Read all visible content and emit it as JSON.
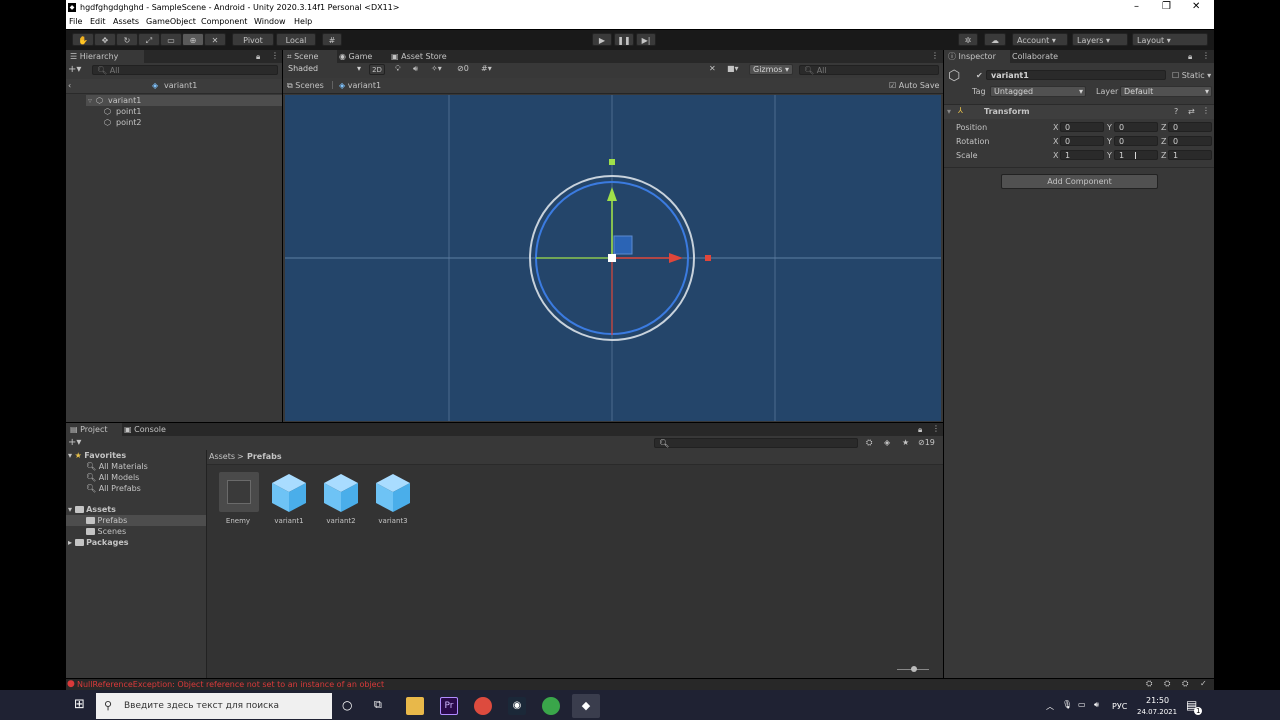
{
  "window": {
    "title": "hgdfghgdghghd - SampleScene - Android - Unity 2020.3.14f1 Personal <DX11>",
    "controls": [
      "–",
      "❐",
      "✕"
    ]
  },
  "menu": [
    "File",
    "Edit",
    "Assets",
    "GameObject",
    "Component",
    "Window",
    "Help"
  ],
  "toolbar": {
    "pivot": "Pivot",
    "local": "Local",
    "account": "Account",
    "layers": "Layers",
    "layout": "Layout"
  },
  "hierarchy": {
    "tab": "Hierarchy",
    "search_placeholder": "All",
    "header": "variant1",
    "items": [
      {
        "label": "variant1"
      },
      {
        "label": "point1"
      },
      {
        "label": "point2"
      }
    ]
  },
  "scene": {
    "tabs": [
      "Scene",
      "Game",
      "Asset Store"
    ],
    "shading": "Shaded",
    "mode2d": "2D",
    "hidden_count": "0",
    "gizmos": "Gizmos",
    "search_placeholder": "All",
    "breadcrumb": [
      "Scenes",
      "variant1"
    ],
    "auto_save": "Auto Save"
  },
  "inspector": {
    "tabs": [
      "Inspector",
      "Collaborate"
    ],
    "object_name": "variant1",
    "static": "Static",
    "tag_label": "Tag",
    "tag_value": "Untagged",
    "layer_label": "Layer",
    "layer_value": "Default",
    "component": "Transform",
    "rows": [
      {
        "label": "Position",
        "x": "0",
        "y": "0",
        "z": "0"
      },
      {
        "label": "Rotation",
        "x": "0",
        "y": "0",
        "z": "0"
      },
      {
        "label": "Scale",
        "x": "1",
        "y": "1",
        "z": "1"
      }
    ],
    "axis_labels": [
      "X",
      "Y",
      "Z"
    ],
    "add_component": "Add Component"
  },
  "project": {
    "tabs": [
      "Project",
      "Console"
    ],
    "hidden_count": "19",
    "favorites": "Favorites",
    "favorite_items": [
      "All Materials",
      "All Models",
      "All Prefabs"
    ],
    "assets": "Assets",
    "asset_folders": [
      "Prefabs",
      "Scenes"
    ],
    "packages": "Packages",
    "breadcrumb": [
      "Assets",
      ">",
      "Prefabs"
    ],
    "assets_grid": [
      "Enemy",
      "variant1",
      "variant2",
      "variant3"
    ]
  },
  "status": {
    "error": "NullReferenceException: Object reference not set to an instance of an object"
  },
  "taskbar": {
    "search_placeholder": "Введите здесь текст для поиска",
    "lang": "РУС",
    "time": "21:50",
    "date": "24.07.2021",
    "notif_count": "1"
  },
  "colors": {
    "scene_bg": "#24456a",
    "gizmo_x": "#e0463a",
    "gizmo_y": "#9fe04a",
    "error": "#d93a3a",
    "selected": "#4d4d4d"
  }
}
